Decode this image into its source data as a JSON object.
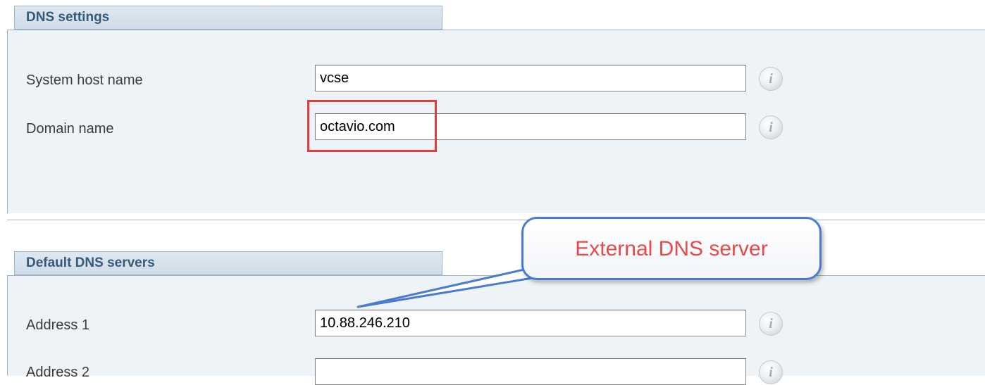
{
  "dns_settings": {
    "title": "DNS settings",
    "fields": [
      {
        "label": "System host name",
        "value": "vcse",
        "info_icon": "info-icon"
      },
      {
        "label": "Domain name",
        "value": "octavio.com",
        "info_icon": "info-icon"
      }
    ]
  },
  "default_dns_servers": {
    "title": "Default DNS servers",
    "fields": [
      {
        "label": "Address 1",
        "value": "10.88.246.210",
        "info_icon": "info-icon"
      },
      {
        "label": "Address 2",
        "value": "",
        "info_icon": "info-icon"
      }
    ]
  },
  "annotation": {
    "callout_text": "External DNS server",
    "highlight_color": "#e03c3c",
    "callout_border_color": "#4a7bd0",
    "callout_text_color": "#e84a4a"
  },
  "info_glyph": "i"
}
